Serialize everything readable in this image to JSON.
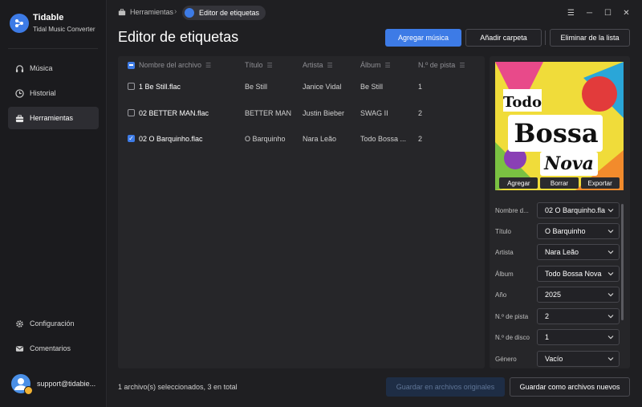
{
  "app": {
    "name": "Tidable",
    "subtitle": "Tidal Music Converter"
  },
  "sidebar": {
    "items": [
      {
        "label": "Música",
        "icon": "headphones-icon"
      },
      {
        "label": "Historial",
        "icon": "clock-icon"
      },
      {
        "label": "Herramientas",
        "icon": "toolbox-icon",
        "active": true
      }
    ],
    "bottom_items": [
      {
        "label": "Configuración",
        "icon": "gear-icon"
      },
      {
        "label": "Comentarios",
        "icon": "mail-icon"
      }
    ],
    "user_email": "support@tidabie..."
  },
  "breadcrumb": {
    "home": "Herramientas",
    "current": "Editor de etiquetas"
  },
  "page": {
    "title": "Editor de etiquetas",
    "buttons": {
      "add_music": "Agregar música",
      "add_folder": "Añadir carpeta",
      "remove_list": "Eliminar de la lista"
    }
  },
  "table": {
    "columns": [
      "Nombre del archivo",
      "Título",
      "Artista",
      "Álbum",
      "N.º de pista"
    ],
    "rows": [
      {
        "checked": false,
        "file": "1 Be Still.flac",
        "title": "Be Still",
        "artist": "Janice Vidal",
        "album": "Be Still",
        "track": "1"
      },
      {
        "checked": false,
        "file": "02 BETTER MAN.flac",
        "title": "BETTER MAN",
        "artist": "Justin Bieber",
        "album": "SWAG II",
        "track": "2"
      },
      {
        "checked": true,
        "file": "02 O Barquinho.flac",
        "title": "O Barquinho",
        "artist": "Nara Leão",
        "album": "Todo Bossa ...",
        "track": "2"
      }
    ]
  },
  "cover": {
    "text_line1": "Todo",
    "text_line2": "Bossa",
    "text_line3": "Nova",
    "actions": [
      "Agregar",
      "Borrar",
      "Exportar"
    ]
  },
  "fields": [
    {
      "label": "Nombre d...",
      "value": "02 O Barquinho.fla"
    },
    {
      "label": "Título",
      "value": "O Barquinho"
    },
    {
      "label": "Artista",
      "value": "Nara Leão"
    },
    {
      "label": "Álbum",
      "value": "Todo Bossa Nova"
    },
    {
      "label": "Año",
      "value": "2025"
    },
    {
      "label": "N.º de pista",
      "value": "2"
    },
    {
      "label": "N.º de disco",
      "value": "1"
    },
    {
      "label": "Género",
      "value": "Vacío"
    }
  ],
  "footer": {
    "status": "1 archivo(s) seleccionados, 3 en total",
    "save_original": "Guardar en archivos originales",
    "save_new": "Guardar como archivos nuevos"
  },
  "colors": {
    "accent": "#3d7be6",
    "background": "#1f1f22",
    "panel": "#262629"
  }
}
